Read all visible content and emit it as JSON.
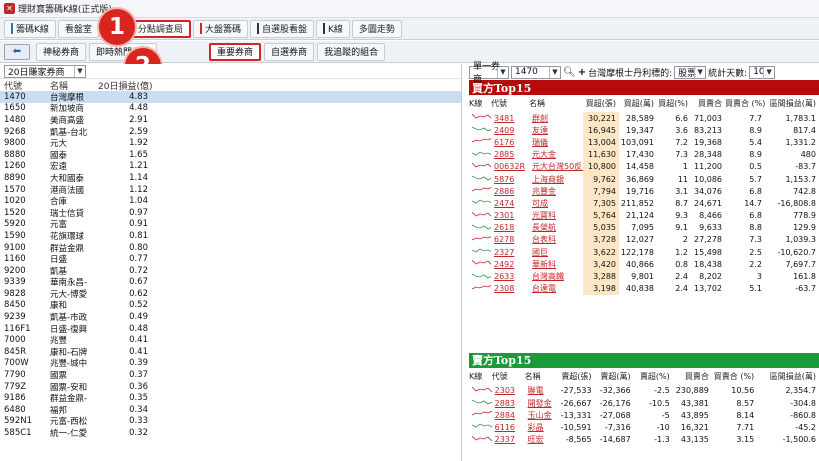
{
  "window": {
    "title": "理財寶籌碼K線(正式版)"
  },
  "main_tabs": [
    {
      "label": "籌碼K線",
      "bar_color": "#2f6fc4"
    },
    {
      "label": "看盤室",
      "bar_color": ""
    },
    {
      "label": "",
      "bar_color": ""
    },
    {
      "label": "分點調查局",
      "bar_color": "#d5232a",
      "active": true
    },
    {
      "label": "大盤籌碼",
      "bar_color": "#d5232a"
    },
    {
      "label": "自選股看盤",
      "bar_color": "#333333"
    },
    {
      "label": "K線",
      "bar_color": "#333333"
    },
    {
      "label": "多圖走勢",
      "bar_color": ""
    }
  ],
  "sub_tabs": [
    {
      "label": "神秘券商"
    },
    {
      "label": "即時熱門券商"
    },
    {
      "label": "重要券商",
      "active": true
    },
    {
      "label": "自選券商"
    },
    {
      "label": "我追蹤的組合"
    }
  ],
  "callouts": [
    "1",
    "2"
  ],
  "left_panel": {
    "filter_value": "20日賺家券商",
    "headers": {
      "code": "代號",
      "name": "名稱",
      "value": "20日損益(億)"
    },
    "rows": [
      {
        "code": "1470",
        "name": "台灣摩根",
        "value": "4.83",
        "selected": true
      },
      {
        "code": "1650",
        "name": "新加坡商",
        "value": "4.48"
      },
      {
        "code": "1480",
        "name": "美商高盛",
        "value": "2.91"
      },
      {
        "code": "9268",
        "name": "凱基-台北",
        "value": "2.59"
      },
      {
        "code": "9800",
        "name": "元大",
        "value": "1.92"
      },
      {
        "code": "8880",
        "name": "國泰",
        "value": "1.65"
      },
      {
        "code": "1260",
        "name": "宏遠",
        "value": "1.21"
      },
      {
        "code": "8890",
        "name": "大和國泰",
        "value": "1.14"
      },
      {
        "code": "1570",
        "name": "港商法國",
        "value": "1.12"
      },
      {
        "code": "1020",
        "name": "合庫",
        "value": "1.04"
      },
      {
        "code": "1520",
        "name": "瑞士信貸",
        "value": "0.97"
      },
      {
        "code": "5920",
        "name": "元富",
        "value": "0.91"
      },
      {
        "code": "1590",
        "name": "花旗環球",
        "value": "0.81"
      },
      {
        "code": "9100",
        "name": "群益金鼎",
        "value": "0.80"
      },
      {
        "code": "1160",
        "name": "日盛",
        "value": "0.77"
      },
      {
        "code": "9200",
        "name": "凱基",
        "value": "0.72"
      },
      {
        "code": "9339",
        "name": "華南永昌-",
        "value": "0.67"
      },
      {
        "code": "9828",
        "name": "元大-博愛",
        "value": "0.62"
      },
      {
        "code": "8450",
        "name": "康和",
        "value": "0.52"
      },
      {
        "code": "9239",
        "name": "凱基-市政",
        "value": "0.49"
      },
      {
        "code": "116F1",
        "name": "日盛-復興",
        "value": "0.48"
      },
      {
        "code": "7000",
        "name": "兆豐",
        "value": "0.41"
      },
      {
        "code": "845R",
        "name": "康和-石牌",
        "value": "0.41"
      },
      {
        "code": "700W",
        "name": "兆豐-城中",
        "value": "0.39"
      },
      {
        "code": "7790",
        "name": "國票",
        "value": "0.37"
      },
      {
        "code": "779Z",
        "name": "國票-安和",
        "value": "0.36"
      },
      {
        "code": "9186",
        "name": "群益金鼎-",
        "value": "0.35"
      },
      {
        "code": "6480",
        "name": "福邦",
        "value": "0.34"
      },
      {
        "code": "592N1",
        "name": "元富-西松",
        "value": "0.33"
      },
      {
        "code": "585C1",
        "name": "統一-仁愛",
        "value": "0.32"
      }
    ]
  },
  "right_panel": {
    "mode_select": "單一券商",
    "broker_select": "1470",
    "broker_label": "台灣摩根士丹利標的:",
    "stock_type_select": "股票",
    "days_label": "統計天數:",
    "days_select": "10",
    "buy_section": {
      "title": "買方Top15",
      "headers": [
        "K線",
        "代號",
        "名稱",
        "買超(張)",
        "買超(萬)",
        "買超(%)",
        "買賣合",
        "買賣合 (%)",
        "區間損益(萬)"
      ],
      "rows": [
        [
          "3481",
          "群創",
          "30,221",
          "28,589",
          "6.6",
          "71,003",
          "7.7",
          "1,783.1"
        ],
        [
          "2409",
          "友達",
          "16,945",
          "19,347",
          "3.6",
          "83,213",
          "8.9",
          "817.4"
        ],
        [
          "6176",
          "瑞儀",
          "13,004",
          "103,091",
          "7.2",
          "19,368",
          "5.4",
          "1,331.2"
        ],
        [
          "2885",
          "元大金",
          "11,630",
          "17,430",
          "7.3",
          "28,348",
          "8.9",
          "480"
        ],
        [
          "00632R",
          "元大台灣50反1",
          "10,800",
          "14,458",
          "1",
          "11,200",
          "0.5",
          "-83.7"
        ],
        [
          "5876",
          "上海商銀",
          "9,762",
          "36,869",
          "11",
          "10,086",
          "5.7",
          "1,153.7"
        ],
        [
          "2886",
          "兆豐金",
          "7,794",
          "19,716",
          "3.1",
          "34,076",
          "6.8",
          "742.8"
        ],
        [
          "2474",
          "可成",
          "7,305",
          "211,852",
          "8.7",
          "24,671",
          "14.7",
          "-16,808.8"
        ],
        [
          "2301",
          "光寶科",
          "5,764",
          "21,124",
          "9.3",
          "8,466",
          "6.8",
          "778.9"
        ],
        [
          "2618",
          "長榮航",
          "5,035",
          "7,095",
          "9.1",
          "9,633",
          "8.8",
          "129.9"
        ],
        [
          "6278",
          "台表科",
          "3,728",
          "12,027",
          "2",
          "27,278",
          "7.3",
          "1,039.3"
        ],
        [
          "2327",
          "國巨",
          "3,622",
          "122,178",
          "1.2",
          "15,498",
          "2.5",
          "-10,620.7"
        ],
        [
          "2492",
          "華新科",
          "3,420",
          "40,866",
          "0.8",
          "18,438",
          "2.2",
          "7,697.7"
        ],
        [
          "2633",
          "台灣高鐵",
          "3,288",
          "9,801",
          "2.4",
          "8,202",
          "3",
          "161.8"
        ],
        [
          "2308",
          "台達電",
          "3,198",
          "40,838",
          "2.4",
          "13,702",
          "5.1",
          "-63.7"
        ]
      ]
    },
    "sell_section": {
      "title": "賣方Top15",
      "headers": [
        "K線",
        "代號",
        "名稱",
        "賣超(張)",
        "賣超(萬)",
        "賣超(%)",
        "買賣合",
        "買賣合 (%)",
        "區間損益(萬)"
      ],
      "rows": [
        [
          "2303",
          "聯電",
          "-27,533",
          "-32,366",
          "-2.5",
          "230,889",
          "10.56",
          "2,354.7"
        ],
        [
          "2883",
          "開發金",
          "-26,667",
          "-26,176",
          "-10.5",
          "43,381",
          "8.57",
          "-304.8"
        ],
        [
          "2884",
          "玉山金",
          "-13,331",
          "-27,068",
          "-5",
          "43,895",
          "8.14",
          "-860.8"
        ],
        [
          "6116",
          "彩晶",
          "-10,591",
          "-7,316",
          "-10",
          "16,321",
          "7.71",
          "-45.2"
        ],
        [
          "2337",
          "旺宏",
          "-8,565",
          "-14,687",
          "-1.3",
          "43,135",
          "3.15",
          "-1,500.6"
        ]
      ]
    }
  }
}
